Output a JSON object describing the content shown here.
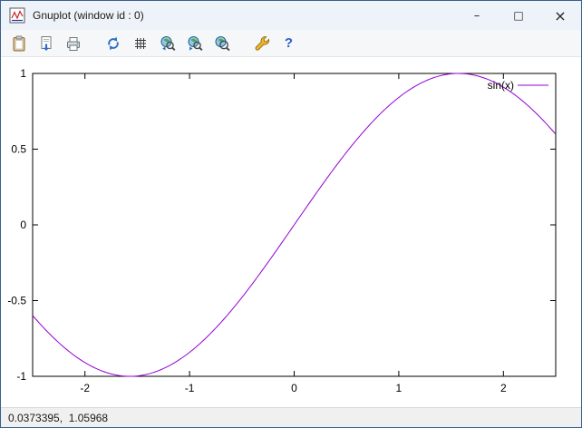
{
  "window": {
    "title": "Gnuplot (window id : 0)",
    "controls": {
      "minimize": "–",
      "maximize": "□",
      "close": "×"
    }
  },
  "toolbar": {
    "icons": [
      "clipboard-icon",
      "save-icon",
      "print-icon",
      "replot-icon",
      "grid-icon",
      "zoom-previous-icon",
      "zoom-next-icon",
      "unzoom-icon",
      "wrench-icon",
      "help-icon"
    ],
    "help_glyph": "?"
  },
  "statusbar": {
    "coordinates": "0.0373395,  1.05968"
  },
  "chart_data": {
    "type": "line",
    "title": "",
    "xlabel": "",
    "ylabel": "",
    "x_range": [
      -2.5,
      2.5
    ],
    "y_range": [
      -1,
      1
    ],
    "x_ticks": [
      -2,
      -1,
      0,
      1,
      2
    ],
    "y_ticks": [
      -1,
      -0.5,
      0,
      0.5,
      1
    ],
    "grid": false,
    "legend_position": "top-right-inside",
    "series": [
      {
        "name": "sin(x)",
        "expression": "sin(x)",
        "color": "#9400d3",
        "samples": 200
      }
    ]
  }
}
